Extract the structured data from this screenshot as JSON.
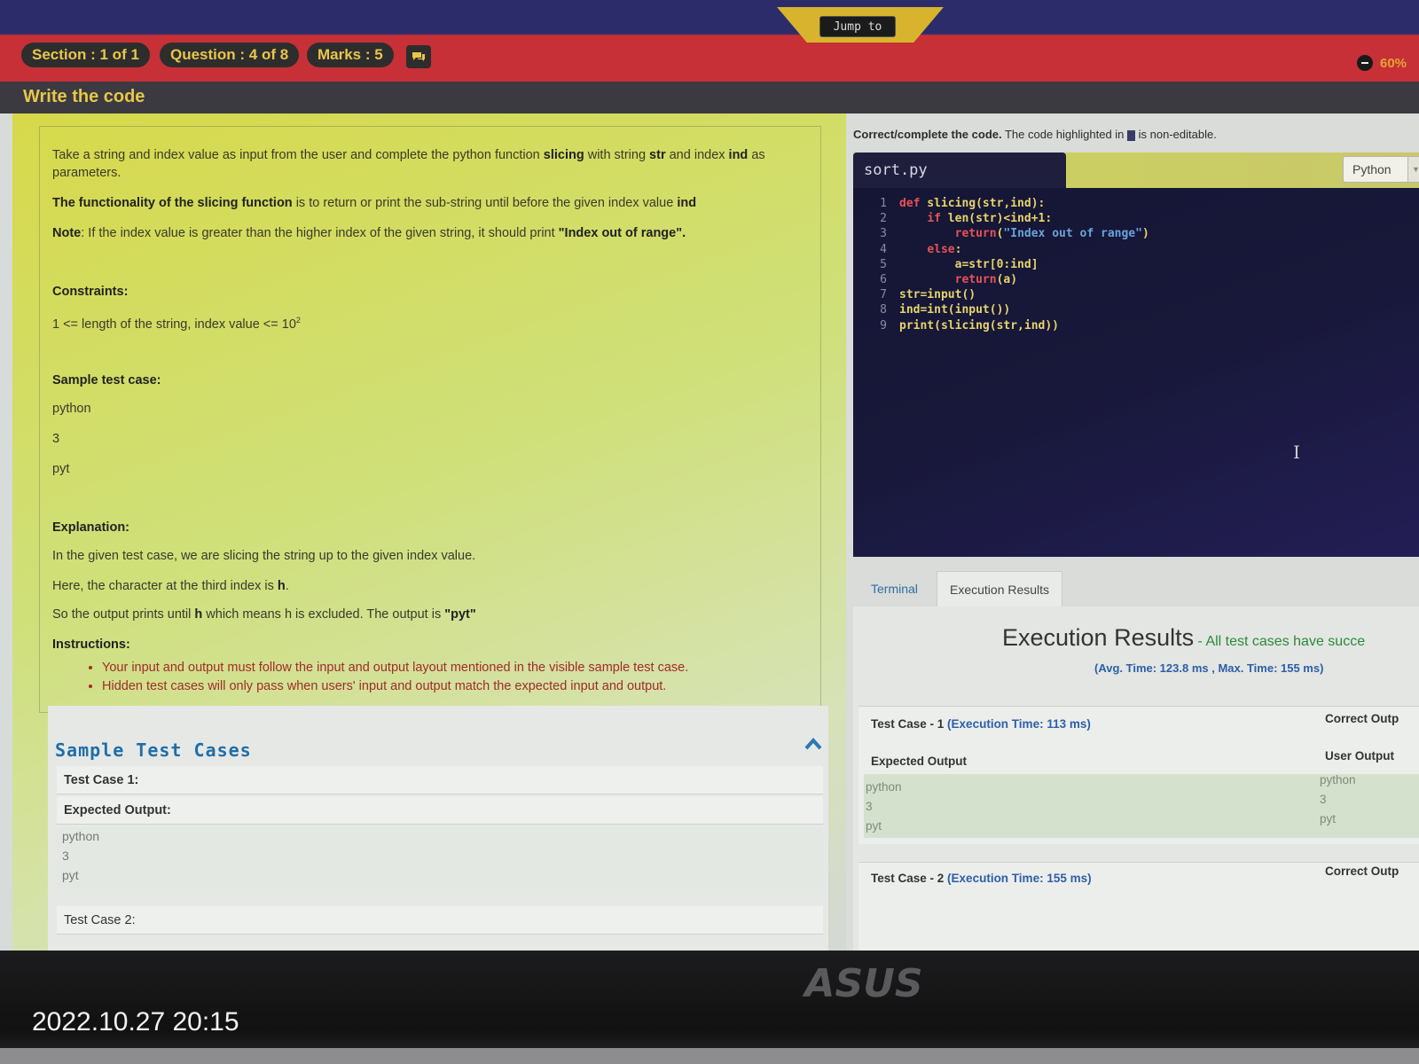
{
  "header": {
    "jump_label": "Jump to",
    "section": "Section : 1 of 1",
    "question": "Question : 4 of 8",
    "marks": "Marks : 5",
    "timer": "60%",
    "page_title": "Write the code"
  },
  "question": {
    "p1_a": "Take a string and index value as input from the user and complete the python function ",
    "p1_b": "slicing",
    "p1_c": " with string ",
    "p1_d": "str",
    "p1_e": " and index ",
    "p1_f": "ind",
    "p1_g": " as parameters.",
    "p2_a": "The functionality of the slicing function",
    "p2_b": " is to return or print the sub-string until before the given index value ",
    "p2_c": "ind",
    "p3_a": "Note",
    "p3_b": ": If the index value is greater than the higher index of the given string, it should print ",
    "p3_c": "\"Index out of range\".",
    "constraints_label": "Constraints:",
    "constraint": "1 <= length of the string, index value <= 10",
    "constraint_sup": "2",
    "sample_label": "Sample test case:",
    "sample_lines": [
      "python",
      "3",
      "pyt"
    ],
    "explanation_label": "Explanation:",
    "explanation_1": "In the given test case, we are slicing the string up to the given index value.",
    "explanation_2a": "Here, the character at the third index is ",
    "explanation_2b": "h",
    "explanation_2c": ".",
    "explanation_3a": "So the output prints until ",
    "explanation_3b": "h",
    "explanation_3c": " which means h is excluded. The output is ",
    "explanation_3d": "\"pyt\"",
    "instructions_label": "Instructions:",
    "instructions": [
      "Your input and output must follow the input and output layout mentioned in the visible sample test case.",
      "Hidden test cases will only pass when users' input and output match the expected input and output."
    ]
  },
  "sample_cases": {
    "title": "Sample Test Cases",
    "case1_label": "Test Case 1:",
    "expected_label": "Expected Output:",
    "case1_lines": [
      "python",
      "3",
      "pyt"
    ],
    "case2_label": "Test Case 2:"
  },
  "editor": {
    "instruction_bold": "Correct/complete the code.",
    "instruction_a": " The code highlighted in ",
    "instruction_b": " is non-editable.",
    "filename": "sort.py",
    "language": "Python",
    "lines": [
      {
        "n": "1",
        "t": "def slicing(str,ind):"
      },
      {
        "n": "2",
        "t": "    if len(str)<ind+1:"
      },
      {
        "n": "3",
        "t": "        return(\"Index out of range\")"
      },
      {
        "n": "4",
        "t": "    else:"
      },
      {
        "n": "5",
        "t": "        a=str[0:ind]"
      },
      {
        "n": "6",
        "t": "        return(a)"
      },
      {
        "n": "7",
        "t": "str=input()"
      },
      {
        "n": "8",
        "t": "ind=int(input())"
      },
      {
        "n": "9",
        "t": "print(slicing(str,ind))"
      }
    ]
  },
  "results": {
    "tab_terminal": "Terminal",
    "tab_execution": "Execution Results",
    "title": "Execution Results",
    "subtitle": " - All test cases have succe",
    "avg": "(Avg. Time: 123.8 ms , Max. Time: 155 ms)",
    "tc1_a": "Test Case - 1 ",
    "tc1_b": "(Execution Time: 113 ms)",
    "tc1_status": "Correct Outp",
    "expected_label": "Expected Output",
    "user_label": "User Output",
    "expected_lines": [
      "python",
      "3",
      "pyt"
    ],
    "user_lines": [
      "python",
      "3",
      "pyt"
    ],
    "tc2_a": "Test Case - 2 ",
    "tc2_b": "(Execution Time: 155 ms)",
    "tc2_status": "Correct Outp"
  },
  "photo": {
    "timestamp": "2022.10.27 20:15",
    "brand": "ASUS"
  }
}
